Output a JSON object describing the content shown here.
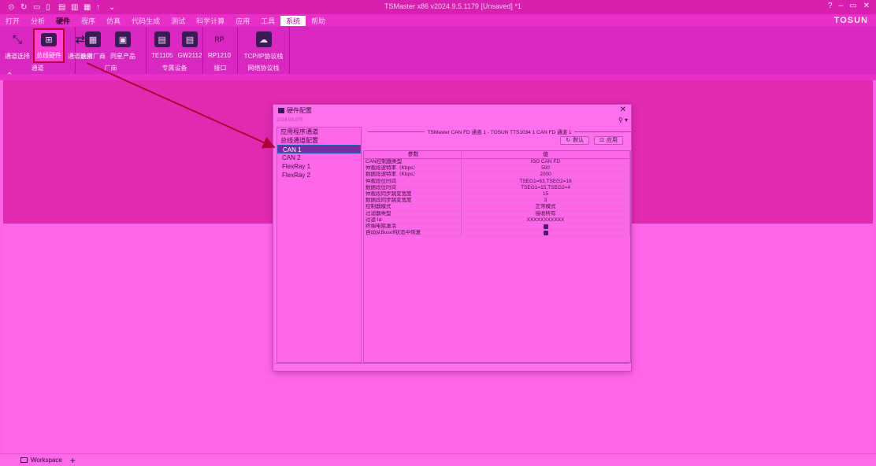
{
  "window": {
    "title": "TSMaster x86 v2024.9.5.1179 [Unsaved] *1"
  },
  "menu": {
    "items": [
      "打开",
      "分析",
      "硬件",
      "程序",
      "仿真",
      "代码生成",
      "测试",
      "科学计算",
      "应用",
      "工具",
      "系统",
      "帮助"
    ],
    "active_index": 2,
    "highlight_index": 10,
    "brand": "TOSUN"
  },
  "ribbon": {
    "groups": [
      {
        "title": "通道",
        "buttons": [
          "通道选择",
          "总线硬件",
          "通道映射"
        ]
      },
      {
        "title": "厂商",
        "buttons": [
          "选择厂商",
          "同星产品"
        ]
      },
      {
        "title": "专属设备",
        "buttons": [
          "TE1105",
          "GW2112"
        ]
      },
      {
        "title": "接口",
        "buttons": [
          "RP1210"
        ]
      },
      {
        "title": "网络协议栈",
        "buttons": [
          "TCP/IP协议栈"
        ]
      }
    ],
    "selected_button": "总线硬件"
  },
  "dialog": {
    "title": "硬件配置",
    "subtitle": "2024.03.070",
    "tree": {
      "root1": "应用程序通道",
      "root2": "总线通道配置",
      "children": [
        "CAN 1",
        "CAN 2",
        "FlexRay 1",
        "FlexRay 2"
      ],
      "selected": "CAN 1"
    },
    "panel_caption": "TSMaster CAN FD 通道 1 - TOSUN TTS1034 1 CAN FD 通道 1",
    "default_button": "默认",
    "apply_button": "应用",
    "table": {
      "headers": [
        "参数",
        "值"
      ],
      "rows": [
        {
          "param": "CAN控制器类型",
          "value": "ISO CAN FD"
        },
        {
          "param": "仲裁段波特率（Kbps）",
          "value": "500"
        },
        {
          "param": "数据段波特率（Kbps）",
          "value": "2000"
        },
        {
          "param": "仲裁段位时间",
          "value": "TSEG1=63,TSEG2=16"
        },
        {
          "param": "数据段位时间",
          "value": "TSEG1=15,TSEG2=4"
        },
        {
          "param": "仲裁段同步跳变宽度",
          "value": "15"
        },
        {
          "param": "数据段同步跳变宽度",
          "value": "3"
        },
        {
          "param": "控制器模式",
          "value": "正常模式"
        },
        {
          "param": "过滤器类型",
          "value": "接收所有"
        },
        {
          "param": "过滤 Id",
          "value": "XXXXXXXXXXX"
        },
        {
          "param": "终端电阻激活",
          "value": ""
        },
        {
          "param": "自动从Busoff状态中恢复",
          "value": ""
        }
      ],
      "checkbox_rows": [
        10,
        11
      ]
    }
  },
  "statusbar": {
    "workspace_tab": "Workspace",
    "add_label": "+"
  }
}
